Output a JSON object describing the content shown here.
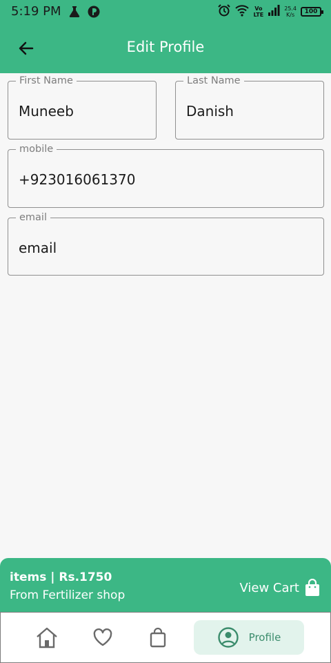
{
  "status_bar": {
    "time": "5:19 PM",
    "icons": [
      "flask-icon",
      "circle-p-icon",
      "alarm-icon",
      "wifi-icon",
      "volte-icon",
      "signal-icon"
    ],
    "volte": "Vo",
    "lte": "LTE",
    "speed_value": "25.4",
    "speed_unit": "K/s",
    "battery": "100"
  },
  "app_bar": {
    "title": "Edit Profile",
    "background": "#3cb785"
  },
  "form": {
    "first_name": {
      "label": "First Name",
      "value": "Muneeb"
    },
    "last_name": {
      "label": "Last Name",
      "value": "Danish"
    },
    "mobile": {
      "label": "mobile",
      "value": "+923016061370"
    },
    "email": {
      "label": "email",
      "value": "email"
    }
  },
  "cart_bar": {
    "summary": "items | Rs.1750",
    "shop": "From Fertilizer shop",
    "action": "View Cart"
  },
  "bottom_nav": {
    "items": [
      "home-icon",
      "heart-icon",
      "shopping-bag-icon"
    ],
    "active": {
      "icon": "profile-icon",
      "label": "Profile"
    },
    "active_color": "#3b8c6c"
  }
}
